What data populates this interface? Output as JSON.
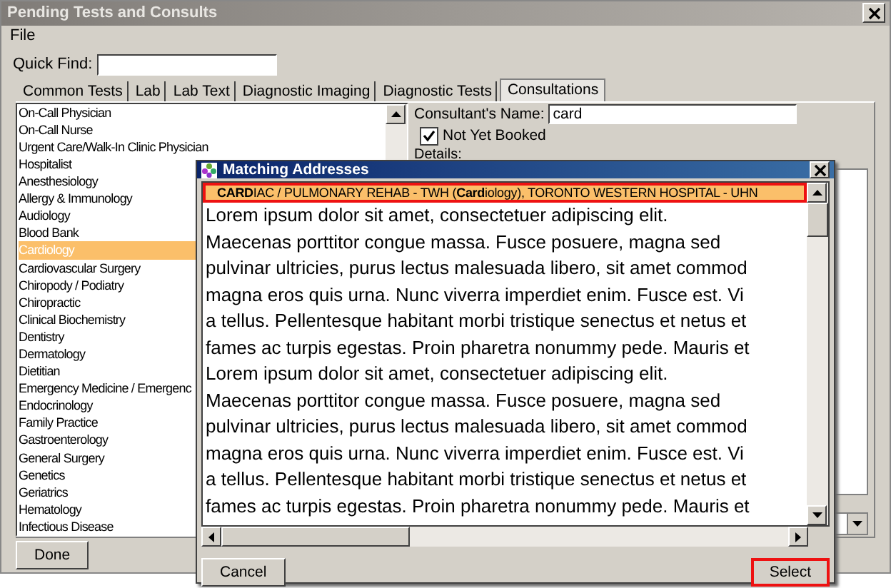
{
  "window": {
    "title": "Pending Tests and Consults"
  },
  "menu": [
    "File"
  ],
  "quick_find": {
    "label": "Quick Find:"
  },
  "tabs": [
    {
      "label": "Common Tests",
      "selected": false
    },
    {
      "label": "Lab",
      "selected": false
    },
    {
      "label": "Lab Text",
      "selected": false
    },
    {
      "label": "Diagnostic Imaging",
      "selected": false
    },
    {
      "label": "Diagnostic Tests",
      "selected": false
    },
    {
      "label": "Consultations",
      "selected": true
    }
  ],
  "specialties": [
    {
      "label": "On-Call Physician",
      "selected": false
    },
    {
      "label": "On-Call Nurse",
      "selected": false
    },
    {
      "label": "Urgent Care/Walk-In Clinic Physician",
      "selected": false
    },
    {
      "label": "Hospitalist",
      "selected": false
    },
    {
      "label": "Anesthesiology",
      "selected": false
    },
    {
      "label": "Allergy & Immunology",
      "selected": false
    },
    {
      "label": "Audiology",
      "selected": false
    },
    {
      "label": "Blood Bank",
      "selected": false
    },
    {
      "label": "Cardiology",
      "selected": true
    },
    {
      "label": "Cardiovascular Surgery",
      "selected": false
    },
    {
      "label": "Chiropody / Podiatry",
      "selected": false
    },
    {
      "label": "Chiropractic",
      "selected": false
    },
    {
      "label": "Clinical Biochemistry",
      "selected": false
    },
    {
      "label": "Dentistry",
      "selected": false
    },
    {
      "label": "Dermatology",
      "selected": false
    },
    {
      "label": "Dietitian",
      "selected": false
    },
    {
      "label": "Emergency Medicine / Emergenc",
      "selected": false
    },
    {
      "label": "Endocrinology",
      "selected": false
    },
    {
      "label": "Family Practice",
      "selected": false
    },
    {
      "label": "Gastroenterology",
      "selected": false
    },
    {
      "label": "General Surgery",
      "selected": false
    },
    {
      "label": "Genetics",
      "selected": false
    },
    {
      "label": "Geriatrics",
      "selected": false
    },
    {
      "label": "Hematology",
      "selected": false
    },
    {
      "label": "Infectious Disease",
      "selected": false
    }
  ],
  "consultant": {
    "label": "Consultant's Name:",
    "value": "card"
  },
  "not_yet_booked": {
    "label": "Not Yet Booked",
    "checked": true
  },
  "details_label": "Details:",
  "done_button": "Done",
  "dialog": {
    "title": "Matching Addresses",
    "results": [
      {
        "text": "**CARD**IAC / PULMONARY REHAB - TWH (**Card**iology),  TORONTO WESTERN HOSPITAL - UHN",
        "selected": true,
        "highlighted": true
      }
    ],
    "preview_lines": [
      "Lorem ipsum dolor sit amet, consectetuer adipiscing elit.",
      "Maecenas porttitor congue massa. Fusce posuere, magna sed",
      "pulvinar ultricies, purus lectus malesuada libero, sit amet commod",
      "magna eros quis urna. Nunc viverra imperdiet enim. Fusce est. Vi",
      "a tellus. Pellentesque habitant morbi tristique senectus et netus et",
      "fames ac turpis egestas. Proin pharetra nonummy pede. Mauris et",
      "Lorem ipsum dolor sit amet, consectetuer adipiscing elit.",
      "Maecenas porttitor congue massa. Fusce posuere, magna sed",
      "pulvinar ultricies, purus lectus malesuada libero, sit amet commod",
      "magna eros quis urna. Nunc viverra imperdiet enim. Fusce est. Vi",
      "a tellus. Pellentesque habitant morbi tristique senectus et netus et",
      "fames ac turpis egestas. Proin pharetra nonummy pede. Mauris et"
    ],
    "buttons": [
      {
        "label": "Cancel",
        "highlighted": false
      },
      {
        "label": "Select",
        "highlighted": true
      }
    ]
  }
}
